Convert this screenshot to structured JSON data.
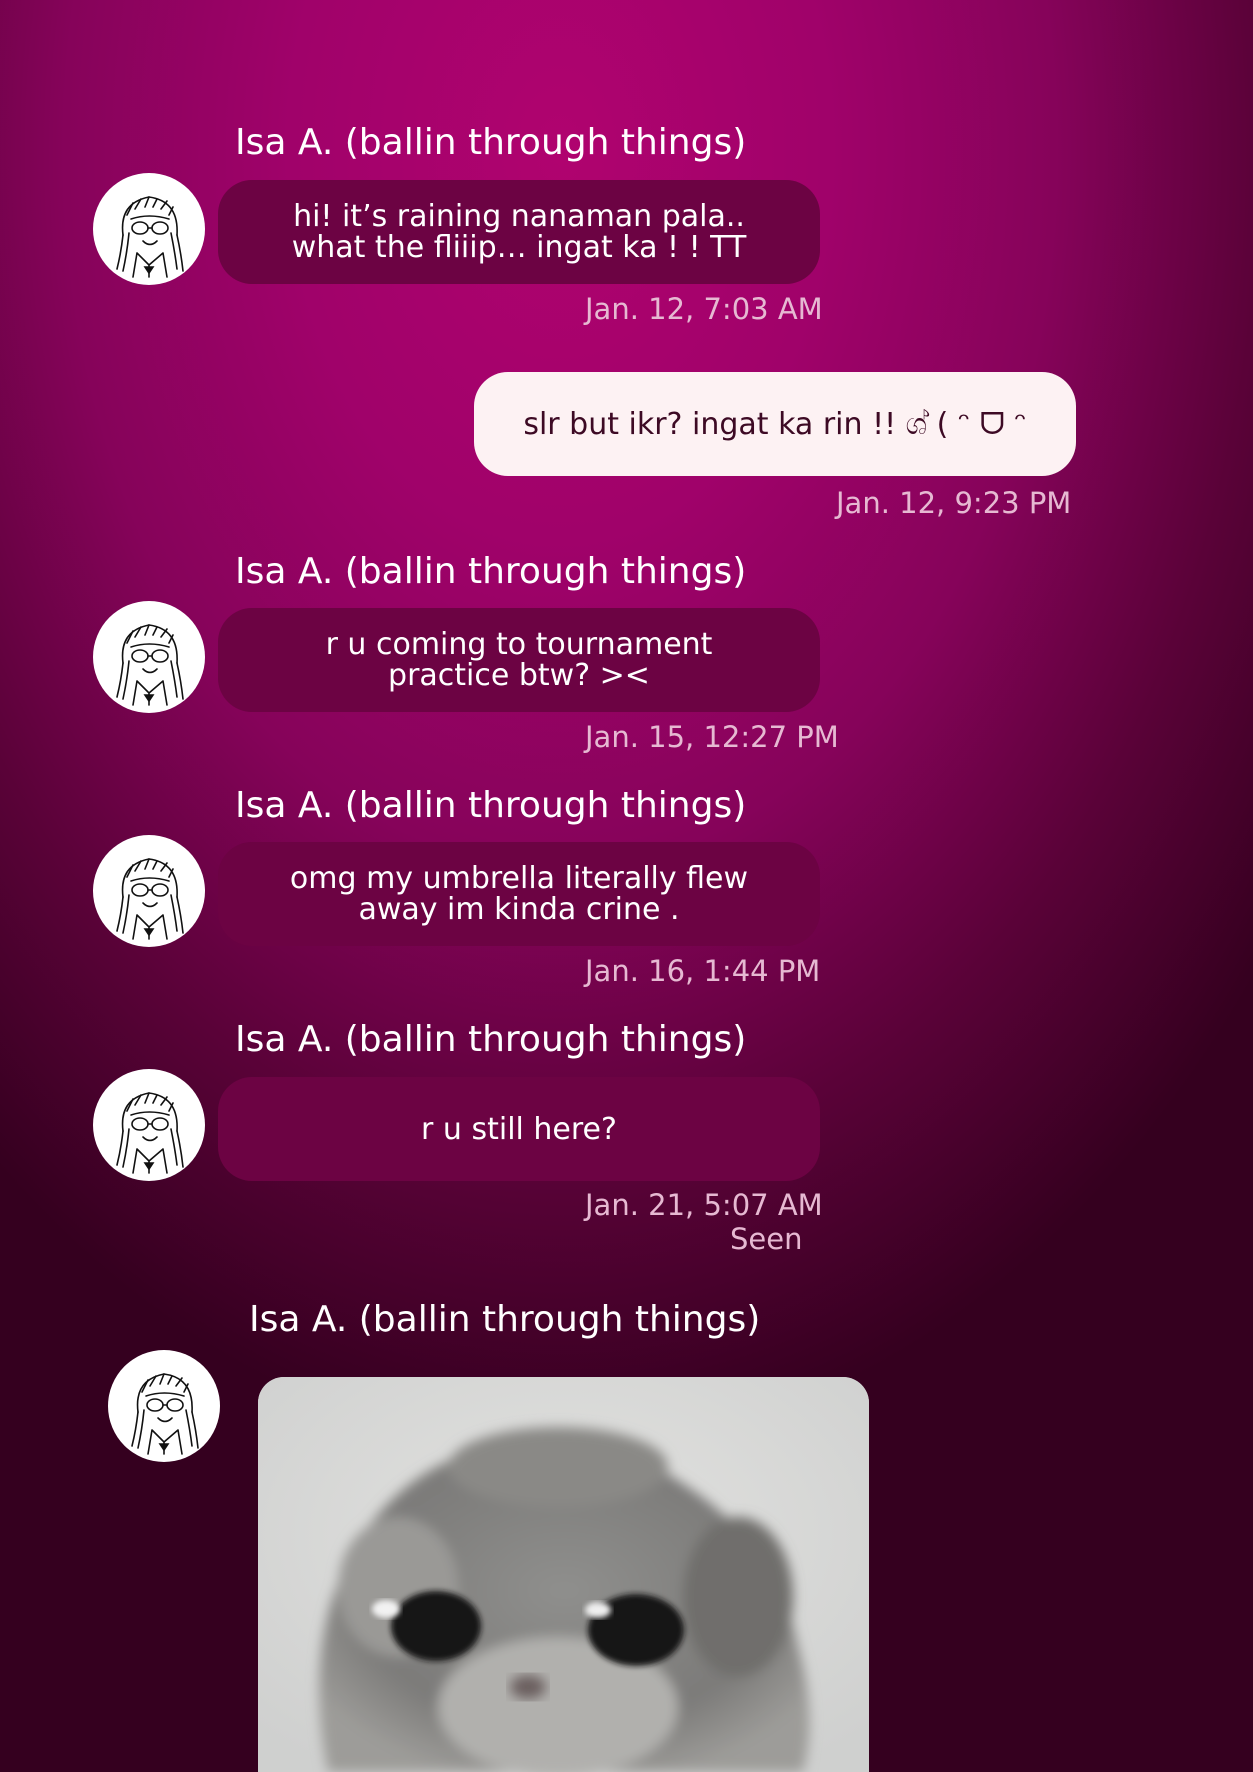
{
  "messages": [
    {
      "sender": "Isa A. (ballin through things)",
      "text": "hi! it’s raining nanaman pala.. what the fliiip… ingat ka ! ! TT",
      "timestamp": "Jan. 12, 7:03 AM"
    },
    {
      "outgoing": true,
      "text": "slr but ikr? ingat ka rin !! ශ් ( ᵔ ᗜ ᵔ",
      "timestamp": "Jan. 12, 9:23 PM"
    },
    {
      "sender": "Isa A. (ballin through things)",
      "text": "r u coming to tournament practice btw? ><",
      "timestamp": "Jan. 15, 12:27 PM"
    },
    {
      "sender": "Isa A. (ballin through things)",
      "text": "omg my umbrella literally flew away im kinda crine .",
      "timestamp": "Jan. 16, 1:44 PM"
    },
    {
      "sender": "Isa A. (ballin through things)",
      "text": "r u still here?",
      "timestamp": "Jan. 21, 5:07 AM",
      "status": "Seen"
    },
    {
      "sender": "Isa A. (ballin through things)",
      "attachment": "sad-hamster-photo"
    }
  ],
  "colors": {
    "background_center": "#b0036f",
    "background_edge": "#35001f",
    "incoming_bubble": "#6c0343",
    "outgoing_bubble": "#fdf2f3",
    "timestamp": "#e6b9d2"
  }
}
